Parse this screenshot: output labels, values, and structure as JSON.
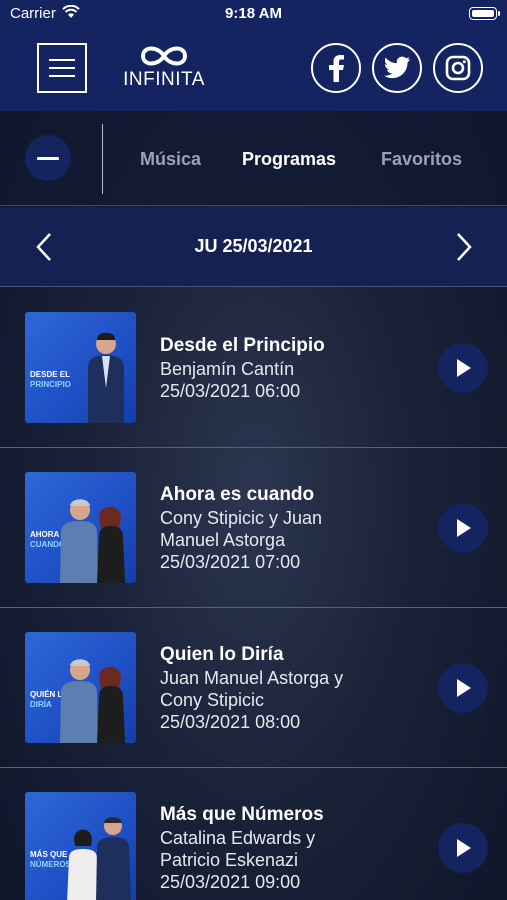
{
  "status_bar": {
    "carrier": "Carrier",
    "time": "9:18 AM"
  },
  "header": {
    "logo_text": "INFINITA",
    "social": [
      "facebook-icon",
      "twitter-icon",
      "instagram-icon"
    ]
  },
  "tabs": [
    {
      "label": "Música",
      "active": false
    },
    {
      "label": "Programas",
      "active": true
    },
    {
      "label": "Favoritos",
      "active": false
    }
  ],
  "date_nav": {
    "date": "JU 25/03/2021"
  },
  "programs": [
    {
      "title": "Desde el Principio",
      "host_lines": [
        "Benjamín Cantín"
      ],
      "datetime": "25/03/2021 06:00",
      "thumb_line1": "DESDE EL",
      "thumb_line2": "PRINCIPIO"
    },
    {
      "title": "Ahora es cuando",
      "host_lines": [
        "Cony Stipicic y Juan",
        "Manuel Astorga"
      ],
      "datetime": "25/03/2021 07:00",
      "thumb_line1": "AHORA ES",
      "thumb_line2": "CUANDO"
    },
    {
      "title": "Quien lo Diría",
      "host_lines": [
        "Juan Manuel Astorga y",
        "Cony Stipicic"
      ],
      "datetime": "25/03/2021 08:00",
      "thumb_line1": "QUIÉN LO",
      "thumb_line2": "DIRÍA"
    },
    {
      "title": "Más que Números",
      "host_lines": [
        "Catalina Edwards y",
        "Patricio Eskenazi"
      ],
      "datetime": "25/03/2021 09:00",
      "thumb_line1": "MÁS QUE",
      "thumb_line2": "NÚMEROS"
    }
  ],
  "colors": {
    "header_blue": "#132460",
    "accent_blue": "#13245e",
    "background": "#1a2238",
    "thumb_blue": "#2f67d8"
  }
}
